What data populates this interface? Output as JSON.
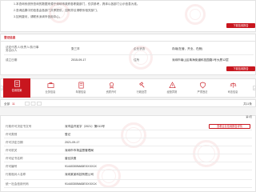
{
  "notice": {
    "line1": "1.本查询系统所查询的数据来源于深圳市政府各职能部门，仅供参考，具体以各部门公示信息为准。",
    "line2": "2.查询结果中的信息由各部门共享提供，如有异议请联系相关部门。",
    "line3": "3.如有疑问，请联系深圳市信用中心。"
  },
  "buttons": {
    "top_right": "下载信用报告",
    "mid_right": "下载信用报告",
    "detail_outline": "查看企业信用报告详情"
  },
  "basic": {
    "section_title": "登记信息",
    "rows": [
      {
        "label": "法定代表人/负责人/执行事务合伙人",
        "value": "张三丰",
        "label2": "企业状态",
        "value2": "存续(在营、开业、在册)"
      },
      {
        "label": "成立日期",
        "value": "2015-09-17",
        "label2": "住所",
        "value2": "深圳市南山区粤海街道科技园路1号大厦12层"
      }
    ]
  },
  "tabs": [
    {
      "label": "信用档案",
      "icon": "archive-icon"
    },
    {
      "label": "业务信息",
      "icon": "briefcase-icon"
    },
    {
      "label": "年报信息",
      "icon": "report-icon"
    },
    {
      "label": "资质许可",
      "icon": "certificate-icon"
    },
    {
      "label": "行政处罚",
      "icon": "gavel-icon"
    },
    {
      "label": "经营异常",
      "icon": "warning-icon"
    },
    {
      "label": "严重违法",
      "icon": "shield-icon"
    },
    {
      "label": "司法信息",
      "icon": "scale-icon"
    }
  ],
  "filter_bar": {
    "left_label": "全部",
    "left_count": "11",
    "right_label": "共11条"
  },
  "record": {
    "page_indicator": "第1页",
    "rows": [
      {
        "label": "行政许可决定书文号",
        "value": "深市监许准字〔2021〕第013号"
      },
      {
        "label": "许可类别",
        "value": "登记"
      },
      {
        "label": "许可决定日期",
        "value": "2021-09-17"
      },
      {
        "label": "许可机关",
        "value": "深圳市市场监督管理局"
      },
      {
        "label": "许可证书名称",
        "value": "营业执照"
      },
      {
        "label": "许可编号",
        "value": "91440300MA5EXXXX1X"
      },
      {
        "label": "行政相对人名称",
        "value": "深圳某某科技有限公司"
      },
      {
        "label": "统一社会信用代码",
        "value": "91440300MA5EXXXX1X"
      }
    ]
  },
  "colors": {
    "accent": "#c8161e",
    "bg": "#f4f4f4"
  }
}
